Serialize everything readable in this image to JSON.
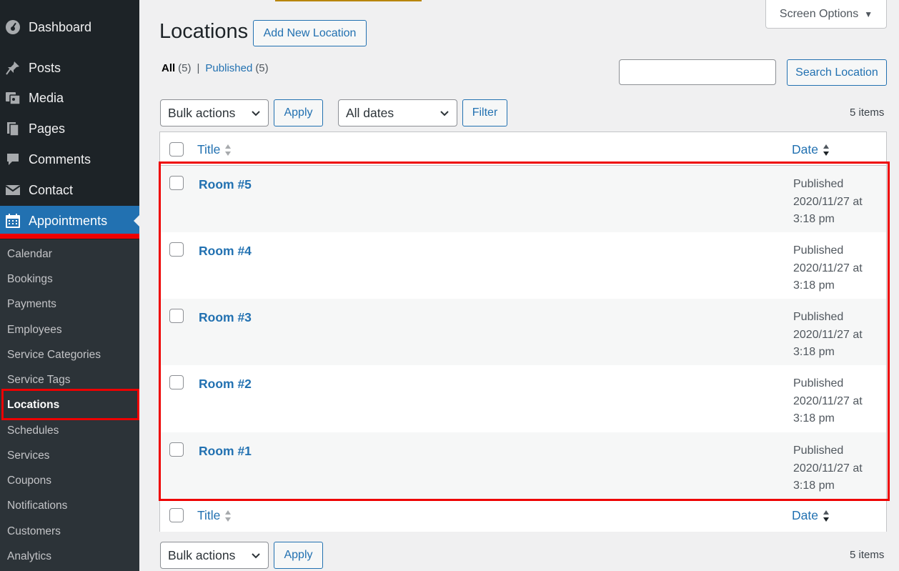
{
  "sidebar": {
    "menu": [
      {
        "label": "Dashboard",
        "icon": "dashboard-icon"
      },
      {
        "label": "Posts",
        "icon": "pin-icon"
      },
      {
        "label": "Media",
        "icon": "media-icon"
      },
      {
        "label": "Pages",
        "icon": "pages-icon"
      },
      {
        "label": "Comments",
        "icon": "comment-icon"
      },
      {
        "label": "Contact",
        "icon": "mail-icon"
      },
      {
        "label": "Appointments",
        "icon": "calendar-icon"
      }
    ],
    "submenu": [
      {
        "label": "Calendar"
      },
      {
        "label": "Bookings"
      },
      {
        "label": "Payments"
      },
      {
        "label": "Employees"
      },
      {
        "label": "Service Categories"
      },
      {
        "label": "Service Tags"
      },
      {
        "label": "Locations"
      },
      {
        "label": "Schedules"
      },
      {
        "label": "Services"
      },
      {
        "label": "Coupons"
      },
      {
        "label": "Notifications"
      },
      {
        "label": "Customers"
      },
      {
        "label": "Analytics"
      }
    ]
  },
  "header": {
    "title": "Locations",
    "add_new": "Add New Location",
    "screen_options": "Screen Options"
  },
  "filters": {
    "all_label": "All",
    "all_count": "(5)",
    "separator": "|",
    "published_label": "Published",
    "published_count": "(5)"
  },
  "search": {
    "value": "",
    "button": "Search Location"
  },
  "toolbar": {
    "bulk_actions": "Bulk actions",
    "apply": "Apply",
    "dates": "All dates",
    "filter": "Filter",
    "items": "5 items"
  },
  "table": {
    "col_title": "Title",
    "col_date": "Date",
    "rows": [
      {
        "title": "Room #5",
        "status": "Published",
        "date": "2020/11/27 at",
        "time": "3:18 pm"
      },
      {
        "title": "Room #4",
        "status": "Published",
        "date": "2020/11/27 at",
        "time": "3:18 pm"
      },
      {
        "title": "Room #3",
        "status": "Published",
        "date": "2020/11/27 at",
        "time": "3:18 pm"
      },
      {
        "title": "Room #2",
        "status": "Published",
        "date": "2020/11/27 at",
        "time": "3:18 pm"
      },
      {
        "title": "Room #1",
        "status": "Published",
        "date": "2020/11/27 at",
        "time": "3:18 pm"
      }
    ]
  },
  "colors": {
    "accent": "#2271b1",
    "sidebar_bg": "#1d2327",
    "highlight": "#e00000"
  }
}
